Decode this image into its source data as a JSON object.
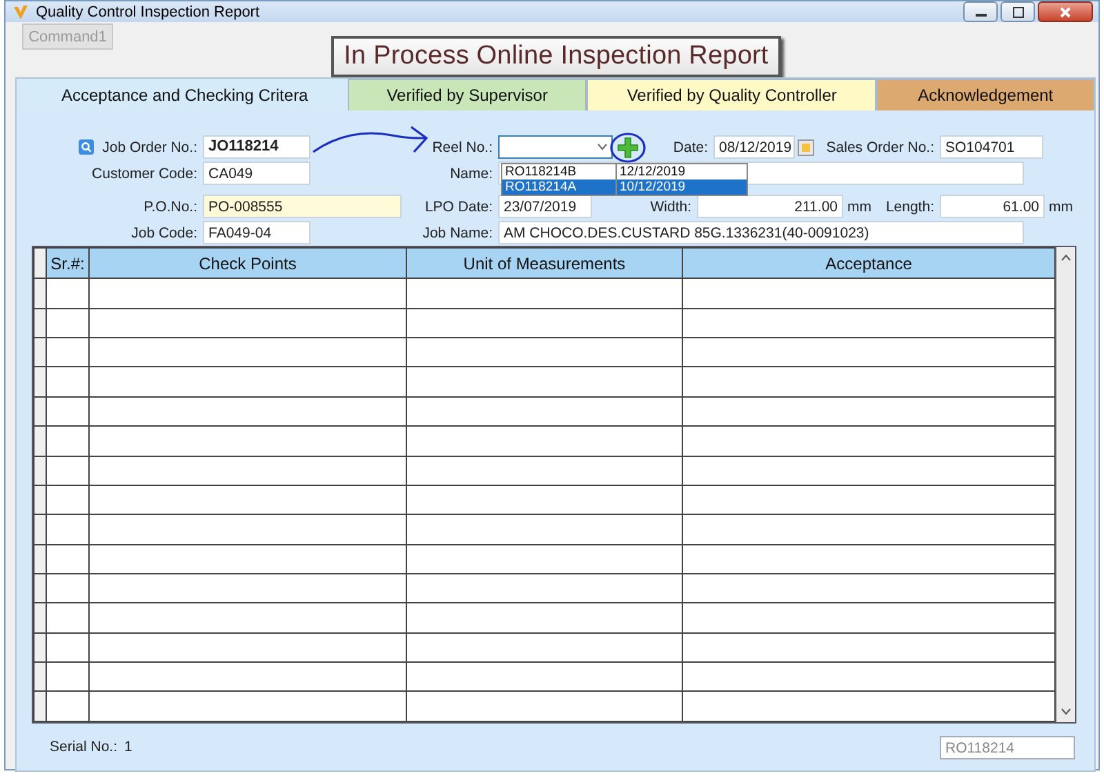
{
  "window": {
    "title": "Quality Control Inspection Report"
  },
  "command_button": {
    "label": "Command1",
    "disabled": true
  },
  "banner": "In Process Online Inspection Report",
  "tabs": [
    {
      "label": "Acceptance and Checking Critera",
      "selected": true,
      "color": "#d6ebfa"
    },
    {
      "label": "Verified by Supervisor",
      "selected": false,
      "color": "#c8e6b8"
    },
    {
      "label": "Verified by Quality Controller",
      "selected": false,
      "color": "#fff9c6"
    },
    {
      "label": "Acknowledgement",
      "selected": false,
      "color": "#dcaa70"
    }
  ],
  "form": {
    "job_order_no": {
      "label": "Job Order No.:",
      "value": "JO118214"
    },
    "customer_code": {
      "label": "Customer Code:",
      "value": "CA049"
    },
    "po_no": {
      "label": "P.O.No.:",
      "value": "PO-008555"
    },
    "job_code": {
      "label": "Job Code:",
      "value": "FA049-04"
    },
    "reel_no": {
      "label": "Reel No.:",
      "expanded": true,
      "options": [
        {
          "reel": "RO118214B",
          "date": "12/12/2019",
          "selected": false
        },
        {
          "reel": "RO118214A",
          "date": "10/12/2019",
          "selected": true
        }
      ]
    },
    "date": {
      "label": "Date:",
      "value": "08/12/2019"
    },
    "sales_order_no": {
      "label": "Sales Order No.:",
      "value": "SO104701"
    },
    "name": {
      "label": "Name:"
    },
    "lpo_date": {
      "label": "LPO Date:",
      "value": "23/07/2019"
    },
    "width": {
      "label": "Width:",
      "value": "211.00",
      "unit": "mm"
    },
    "length": {
      "label": "Length:",
      "value": "61.00",
      "unit": "mm"
    },
    "job_name": {
      "label": "Job Name:",
      "value": "AM CHOCO.DES.CUSTARD 85G.1336231(40-0091023)"
    }
  },
  "table": {
    "columns": [
      "Sr.#:",
      "Check Points",
      "Unit of Measurements",
      "Acceptance"
    ]
  },
  "footer": {
    "serial_label": "Serial No.:",
    "serial_value": "1",
    "reel_field": {
      "value": "RO118214",
      "disabled": true
    }
  }
}
